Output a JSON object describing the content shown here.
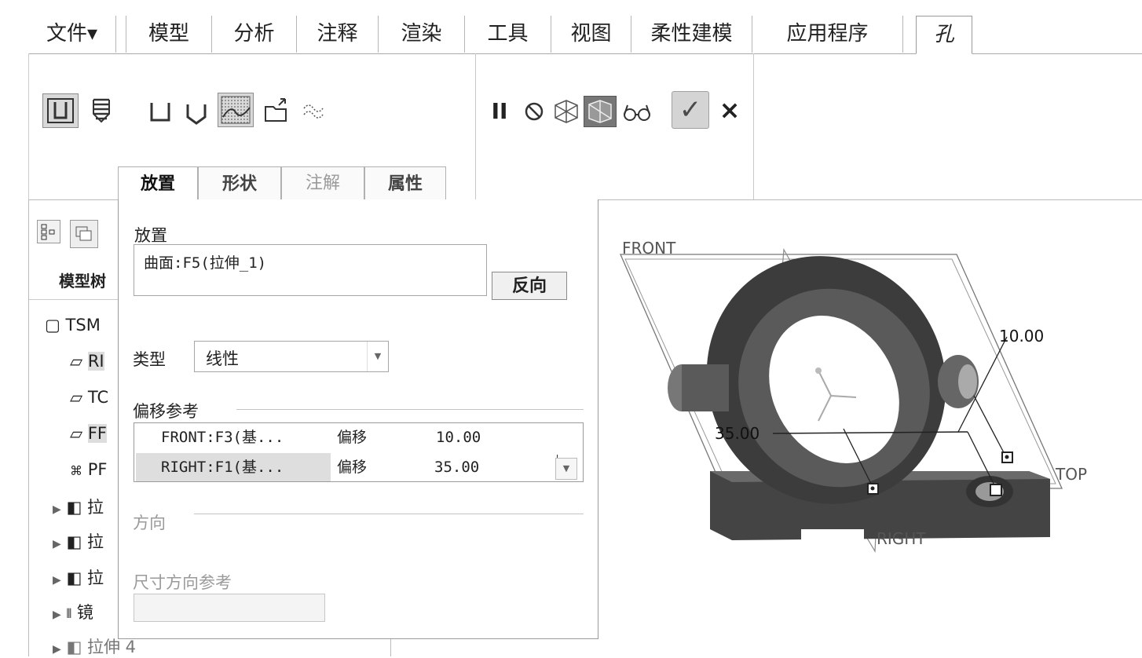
{
  "ribbon_tabs": [
    {
      "label": "文件▾"
    },
    {
      "label": "模型"
    },
    {
      "label": "分析"
    },
    {
      "label": "注释"
    },
    {
      "label": "渲染"
    },
    {
      "label": "工具"
    },
    {
      "label": "视图"
    },
    {
      "label": "柔性建模"
    },
    {
      "label": "应用程序"
    },
    {
      "label": "孔",
      "active": true
    }
  ],
  "sub_tabs": [
    {
      "label": "放置",
      "active": true
    },
    {
      "label": "形状"
    },
    {
      "label": "注解"
    },
    {
      "label": "属性"
    }
  ],
  "ribbon_actions": {
    "pause_label": "II",
    "ok_label": "✓",
    "cancel_label": "×"
  },
  "model_tree": {
    "header": "模型树",
    "items": [
      {
        "label": "TSM"
      },
      {
        "label": "RI"
      },
      {
        "label": "TC"
      },
      {
        "label": "FF"
      },
      {
        "label": "PF"
      },
      {
        "label": "拉"
      },
      {
        "label": "拉"
      },
      {
        "label": "拉"
      },
      {
        "label": "镜"
      },
      {
        "label": "拉伸 4"
      }
    ]
  },
  "placement": {
    "section_label": "放置",
    "reference_value": "曲面:F5(拉伸_1)",
    "flip_button": "反向",
    "type_label": "类型",
    "type_value": "线性",
    "offset_refs_label": "偏移参考",
    "offset_rows": [
      {
        "reference": "FRONT:F3(基...",
        "mode": "偏移",
        "value": "10.00"
      },
      {
        "reference": "RIGHT:F1(基...",
        "mode": "偏移",
        "value": "35.00"
      }
    ],
    "direction_label": "方向",
    "dim_dir_ref_label": "尺寸方向参考"
  },
  "viewport": {
    "plane_labels": {
      "front": "FRONT",
      "top": "TOP",
      "right": "RIGHT"
    },
    "dimensions": {
      "dim1": "10.00",
      "dim2": "35.00"
    }
  },
  "colors": {
    "part_dark": "#3c3c3c",
    "part_mid": "#6a6a6a",
    "accent_check": "#4a4a4a"
  }
}
